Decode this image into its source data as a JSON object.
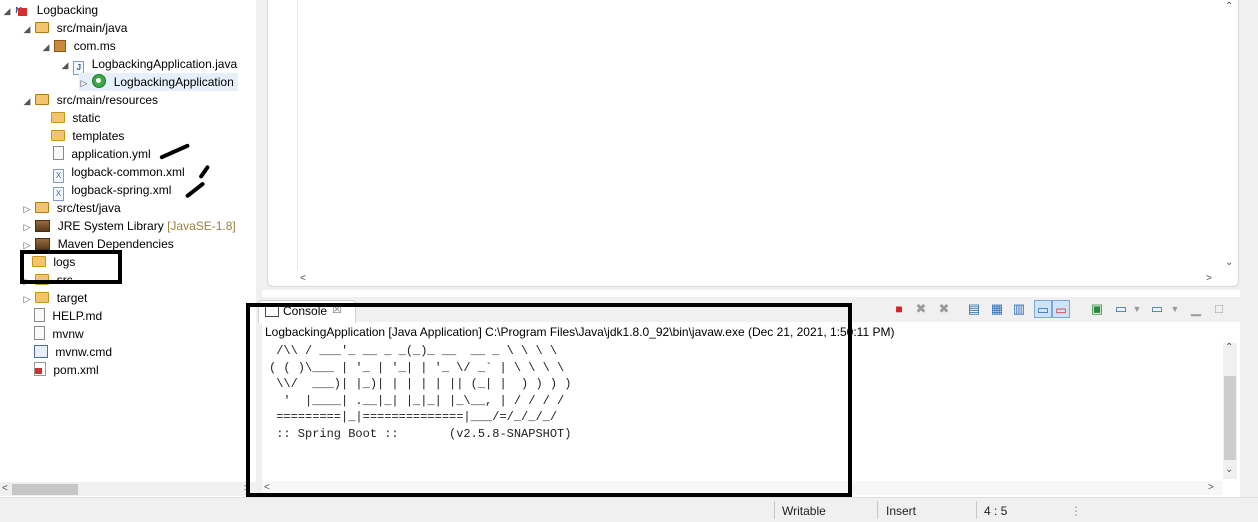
{
  "explorer": {
    "items": [
      {
        "label": "Logbacking",
        "icon": "maven-project-icon"
      },
      {
        "label": "src/main/java",
        "icon": "source-folder-icon"
      },
      {
        "label": "com.ms",
        "icon": "package-icon"
      },
      {
        "label": "LogbackingApplication.java",
        "icon": "java-file-icon"
      },
      {
        "label": "LogbackingApplication",
        "icon": "spring-boot-class-icon"
      },
      {
        "label": "src/main/resources",
        "icon": "source-folder-icon"
      },
      {
        "label": "static",
        "icon": "folder-icon"
      },
      {
        "label": "templates",
        "icon": "folder-icon"
      },
      {
        "label": "application.yml",
        "icon": "text-file-icon"
      },
      {
        "label": "logback-common.xml",
        "icon": "xml-file-icon"
      },
      {
        "label": "logback-spring.xml",
        "icon": "xml-file-icon"
      },
      {
        "label": "src/test/java",
        "icon": "source-folder-icon"
      },
      {
        "label": "JRE System Library",
        "tag": "[JavaSE-1.8]",
        "icon": "library-icon"
      },
      {
        "label": "Maven Dependencies",
        "icon": "library-icon"
      },
      {
        "label": "logs",
        "icon": "folder-icon"
      },
      {
        "label": "src",
        "icon": "folder-icon"
      },
      {
        "label": "target",
        "icon": "folder-icon"
      },
      {
        "label": "HELP.md",
        "icon": "text-file-icon"
      },
      {
        "label": "mvnw",
        "icon": "text-file-icon"
      },
      {
        "label": "mvnw.cmd",
        "icon": "cmd-file-icon"
      },
      {
        "label": "pom.xml",
        "icon": "pom-file-icon"
      }
    ]
  },
  "console": {
    "tab_label": "Console",
    "tab_close": "☒",
    "header": "LogbackingApplication [Java Application] C:\\Program Files\\Java\\jdk1.8.0_92\\bin\\javaw.exe (Dec 21, 2021, 1:50:11 PM)",
    "banner_lines": [
      " /\\\\ / ___'_ __ _ _(_)_ __  __ _ \\ \\ \\ \\",
      "( ( )\\___ | '_ | '_| | '_ \\/ _` | \\ \\ \\ \\",
      " \\\\/  ___)| |_)| | | | | || (_| |  ) ) ) )",
      "  '  |____| .__|_| |_|_| |_\\__, | / / / /",
      " =========|_|==============|___/=/_/_/_/",
      " :: Spring Boot ::       (v2.5.8-SNAPSHOT)"
    ]
  },
  "statusbar": {
    "writable": "Writable",
    "insert_mode": "Insert",
    "cursor_position": "4 : 5"
  },
  "colors": {
    "annotation": "#000000",
    "folder": "#f2c46d",
    "terminate_button": "#d32222",
    "toolbar_toggle": "#cfe3f7"
  }
}
